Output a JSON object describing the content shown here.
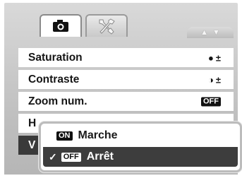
{
  "tabs": [
    {
      "name": "camera",
      "icon": "camera-icon",
      "selected": true
    },
    {
      "name": "setup",
      "icon": "wrench-screwdriver-icon",
      "selected": false
    }
  ],
  "scroll": {
    "up": "▲",
    "down": "▼"
  },
  "menu": {
    "saturation": {
      "label": "Saturation",
      "value_icon": "●",
      "value_suffix": "±"
    },
    "contrast": {
      "label": "Contraste",
      "value_icon": "◑",
      "value_suffix": "±"
    },
    "digital_zoom": {
      "label": "Zoom num.",
      "value": "OFF"
    },
    "row4": {
      "label": "H"
    },
    "row5": {
      "label": "V"
    }
  },
  "popup": {
    "options": [
      {
        "badge": "ON",
        "label": "Marche",
        "selected": false
      },
      {
        "badge": "OFF",
        "label": "Arrêt",
        "selected": true,
        "check": "✓"
      }
    ]
  },
  "colors": {
    "highlight": "#3a3a3a",
    "background": "#c4c4c4"
  }
}
